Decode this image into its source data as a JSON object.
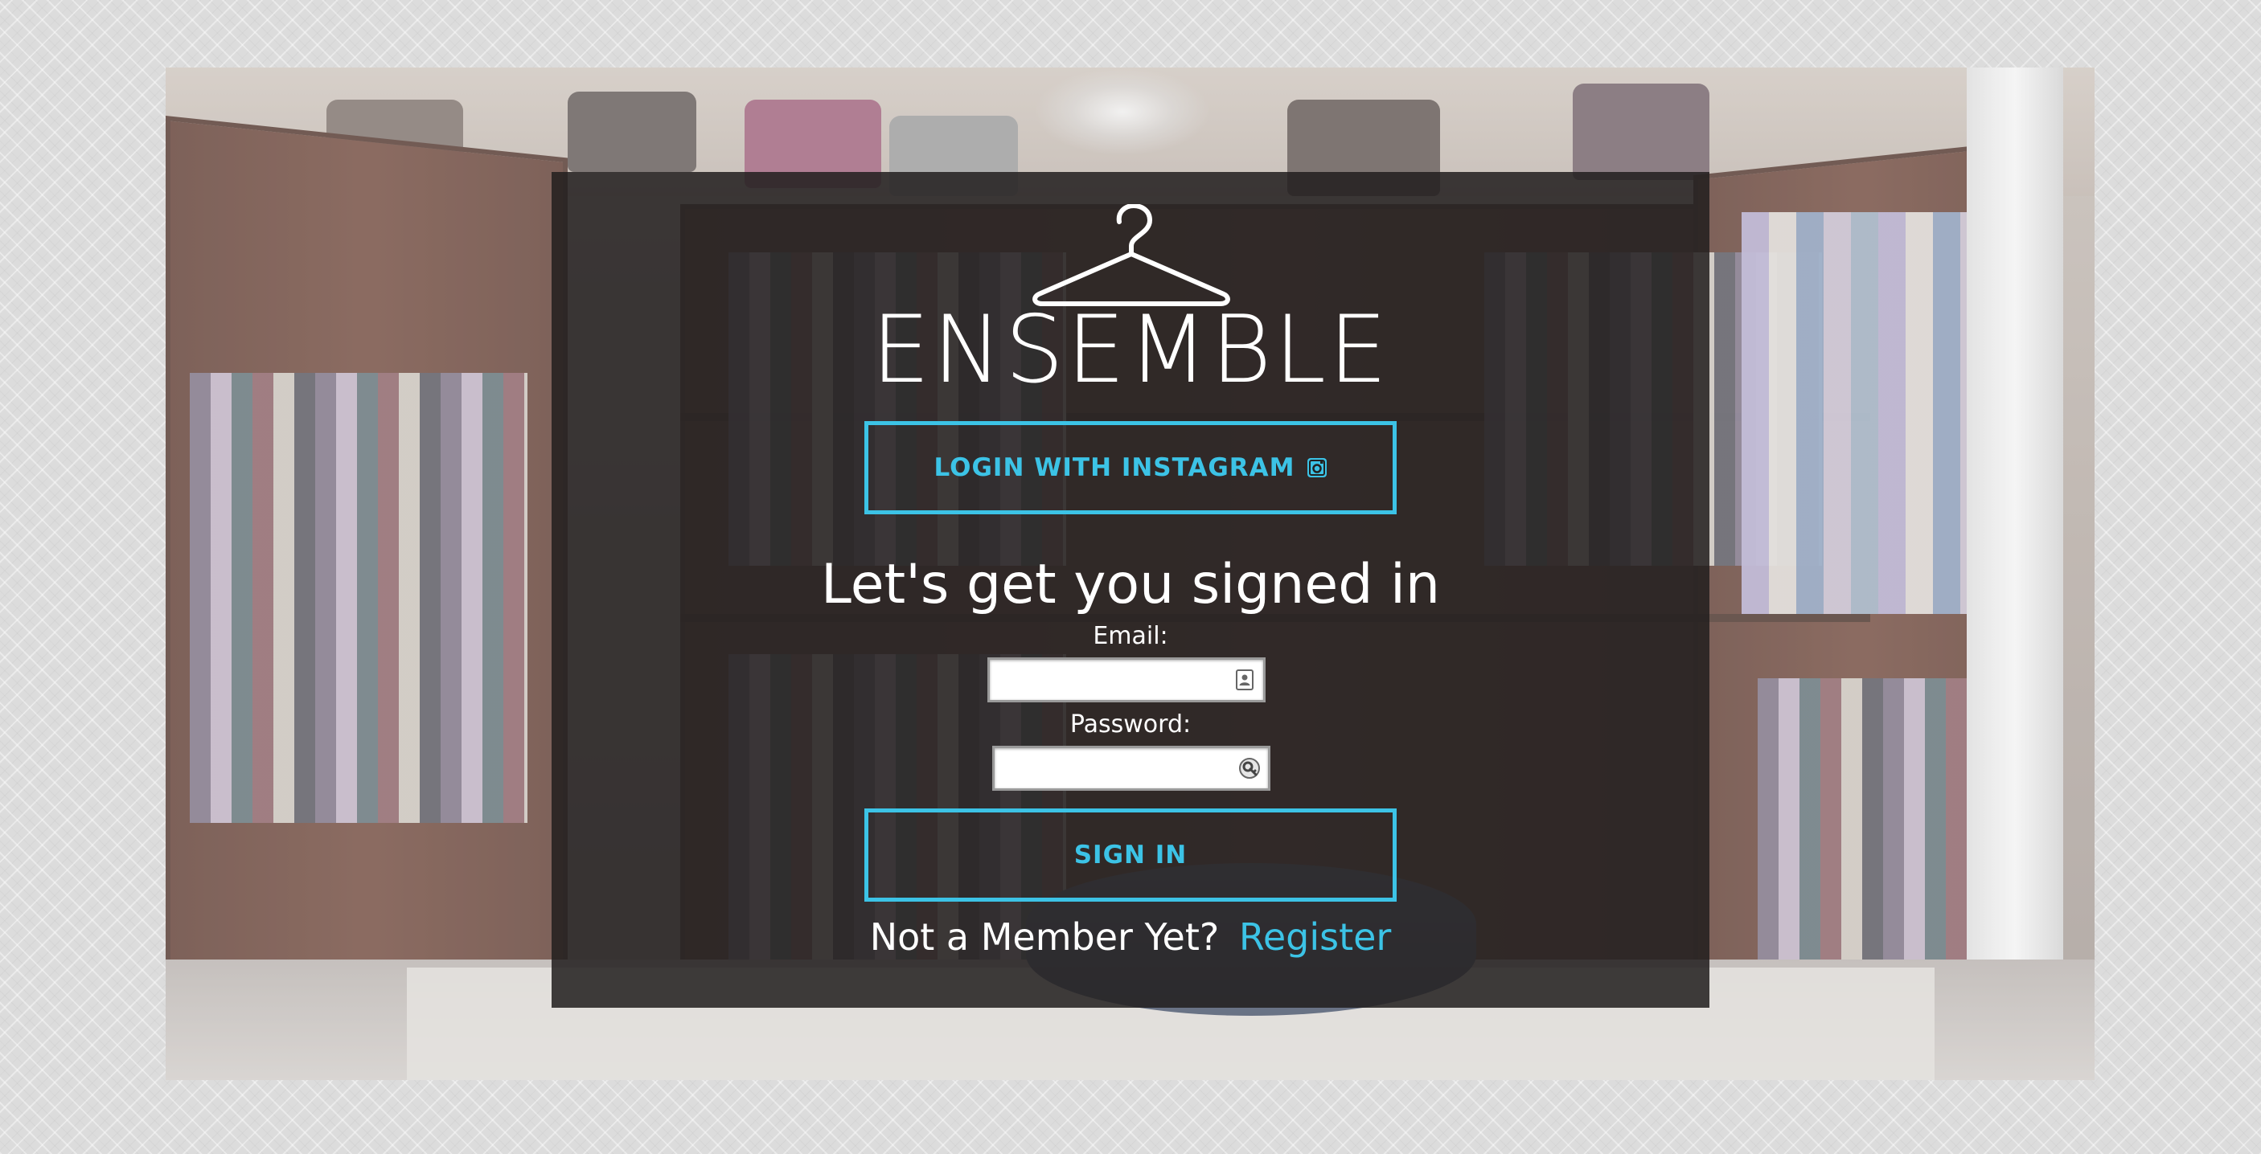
{
  "brand": {
    "name": "ENSEMBLE",
    "logo_icon": "hanger-icon"
  },
  "instagram_button": {
    "label": "LOGIN WITH INSTAGRAM",
    "icon": "instagram-icon"
  },
  "form": {
    "heading": "Let's get you signed in",
    "email_label": "Email:",
    "email_value": "",
    "email_icon": "contact-card-icon",
    "password_label": "Password:",
    "password_value": "",
    "password_icon": "key-manager-icon",
    "submit_label": "SIGN IN"
  },
  "register": {
    "prompt": "Not a Member Yet?",
    "link_label": "Register"
  },
  "colors": {
    "accent": "#3cc3e6",
    "card_background": "rgba(34,30,30,0.86)",
    "page_background": "#dcdcdc",
    "text": "#ffffff"
  },
  "background_image": "walk-in-closet-photo"
}
